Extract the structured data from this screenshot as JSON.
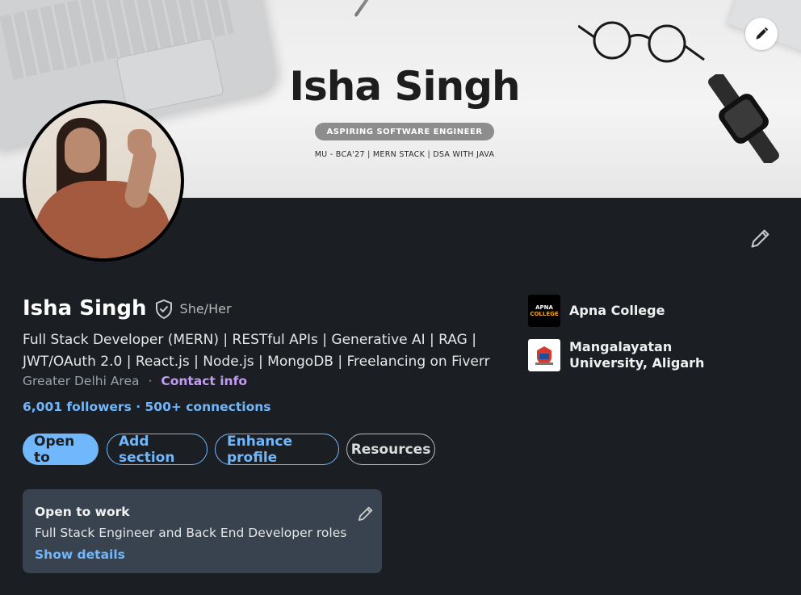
{
  "banner": {
    "name": "Isha Singh",
    "tagline": "ASPIRING SOFTWARE ENGINEER",
    "subline": "MU - BCA'27  |  MERN STACK  |  DSA WITH JAVA",
    "edit_icon": "pencil-icon"
  },
  "profile": {
    "name": "Isha Singh",
    "verified_icon": "verified-shield-icon",
    "pronouns": "She/Her",
    "headline": "Full Stack Developer (MERN) | RESTful APIs | Generative AI | RAG | JWT/OAuth 2.0 | React.js | Node.js | MongoDB | Freelancing on Fiverr",
    "location": "Greater Delhi Area",
    "location_separator": "·",
    "contact_info": "Contact info",
    "followers": "6,001 followers",
    "connections_separator": "·",
    "connections": "500+ connections"
  },
  "organizations": [
    {
      "name": "Apna College",
      "logo_line1": "APNA",
      "logo_line2": "COLLEGE"
    },
    {
      "name": "Mangalayatan University, Aligarh"
    }
  ],
  "actions": {
    "open_to": "Open to",
    "add_section": "Add section",
    "enhance_profile": "Enhance profile",
    "resources": "Resources"
  },
  "open_to_work": {
    "title": "Open to work",
    "description": "Full Stack Engineer and Back End Developer roles",
    "link": "Show details"
  },
  "colors": {
    "background": "#1b1f23",
    "accent_blue": "#71b7fb",
    "contact_purple": "#c39cf2",
    "card": "#38434f"
  }
}
